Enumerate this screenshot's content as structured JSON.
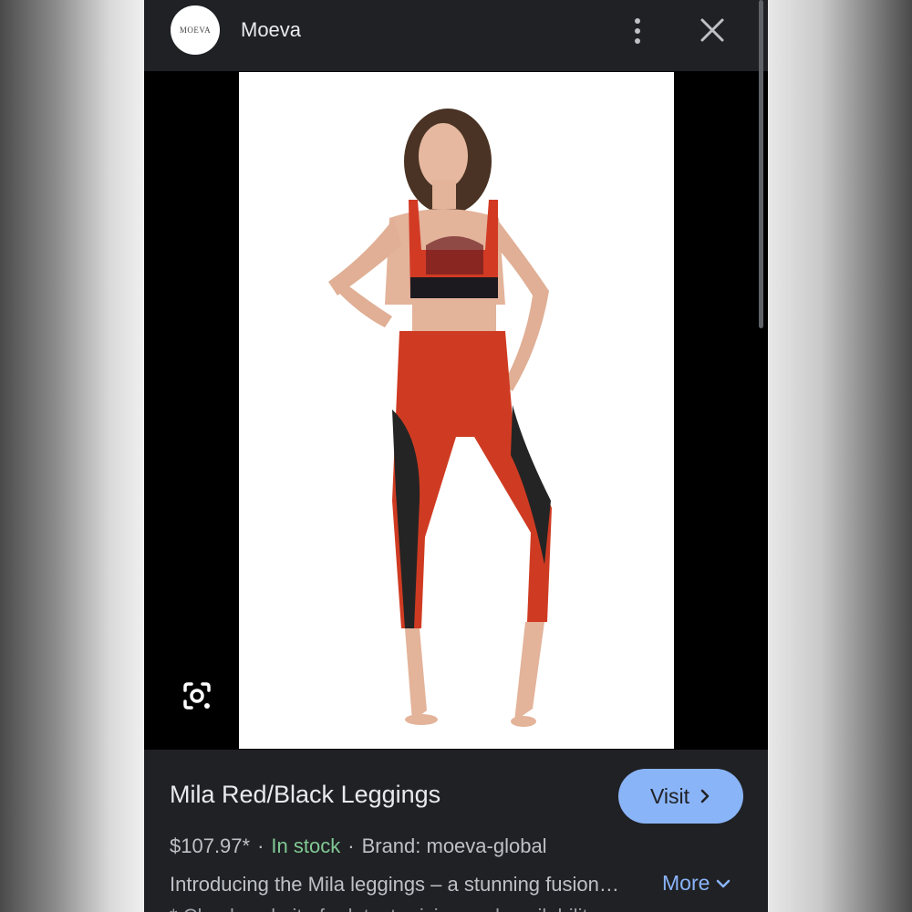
{
  "header": {
    "logo_text": "MOEVA",
    "site_name": "Moeva",
    "icons": {
      "menu": "more-vertical-icon",
      "close": "close-icon"
    }
  },
  "media": {
    "image_subject": "model-in-red-black-sports-bra-and-leggings",
    "lens_icon": "google-lens-icon"
  },
  "product": {
    "title": "Mila Red/Black Leggings",
    "visit_label": "Visit",
    "price": "$107.97*",
    "stock": "In stock",
    "brand": "Brand: moeva-global",
    "description": "Introducing the Mila leggings – a stunning fusion…",
    "more_label": "More",
    "cutoff_line": "* Check website for latest pricing and availability"
  },
  "colors": {
    "background": "#202124",
    "accent": "#8ab4f8",
    "in_stock": "#81c995",
    "text": "#e8eaed",
    "secondary_text": "#bdc1c6"
  }
}
